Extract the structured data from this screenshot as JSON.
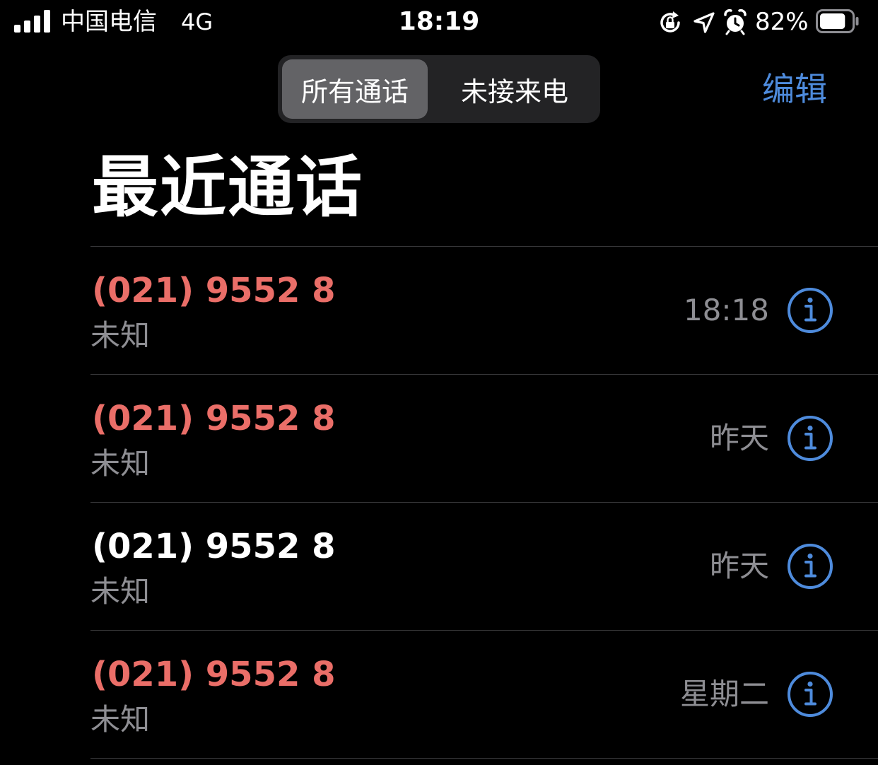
{
  "status_bar": {
    "carrier": "中国电信",
    "network": "4G",
    "time": "18:19",
    "battery_percent": "82%",
    "battery_level": 0.82,
    "icons": [
      "signal-icon",
      "rotation-lock-icon",
      "location-icon",
      "alarm-icon",
      "battery-icon"
    ]
  },
  "nav": {
    "segments": [
      "所有通话",
      "未接来电"
    ],
    "selected_segment": "所有通话",
    "edit_label": "编辑"
  },
  "title": "最近通话",
  "calls": [
    {
      "number": "(021) 9552 8",
      "label": "未知",
      "time": "18:18",
      "missed": true
    },
    {
      "number": "(021) 9552 8",
      "label": "未知",
      "time": "昨天",
      "missed": true
    },
    {
      "number": "(021) 9552 8",
      "label": "未知",
      "time": "昨天",
      "missed": false
    },
    {
      "number": "(021) 9552 8",
      "label": "未知",
      "time": "星期二",
      "missed": true
    }
  ],
  "colors": {
    "background": "#000000",
    "missed": "#ea6e68",
    "accent": "#4e8bdc",
    "secondary_text": "#8e8e93",
    "separator": "#38383a"
  }
}
